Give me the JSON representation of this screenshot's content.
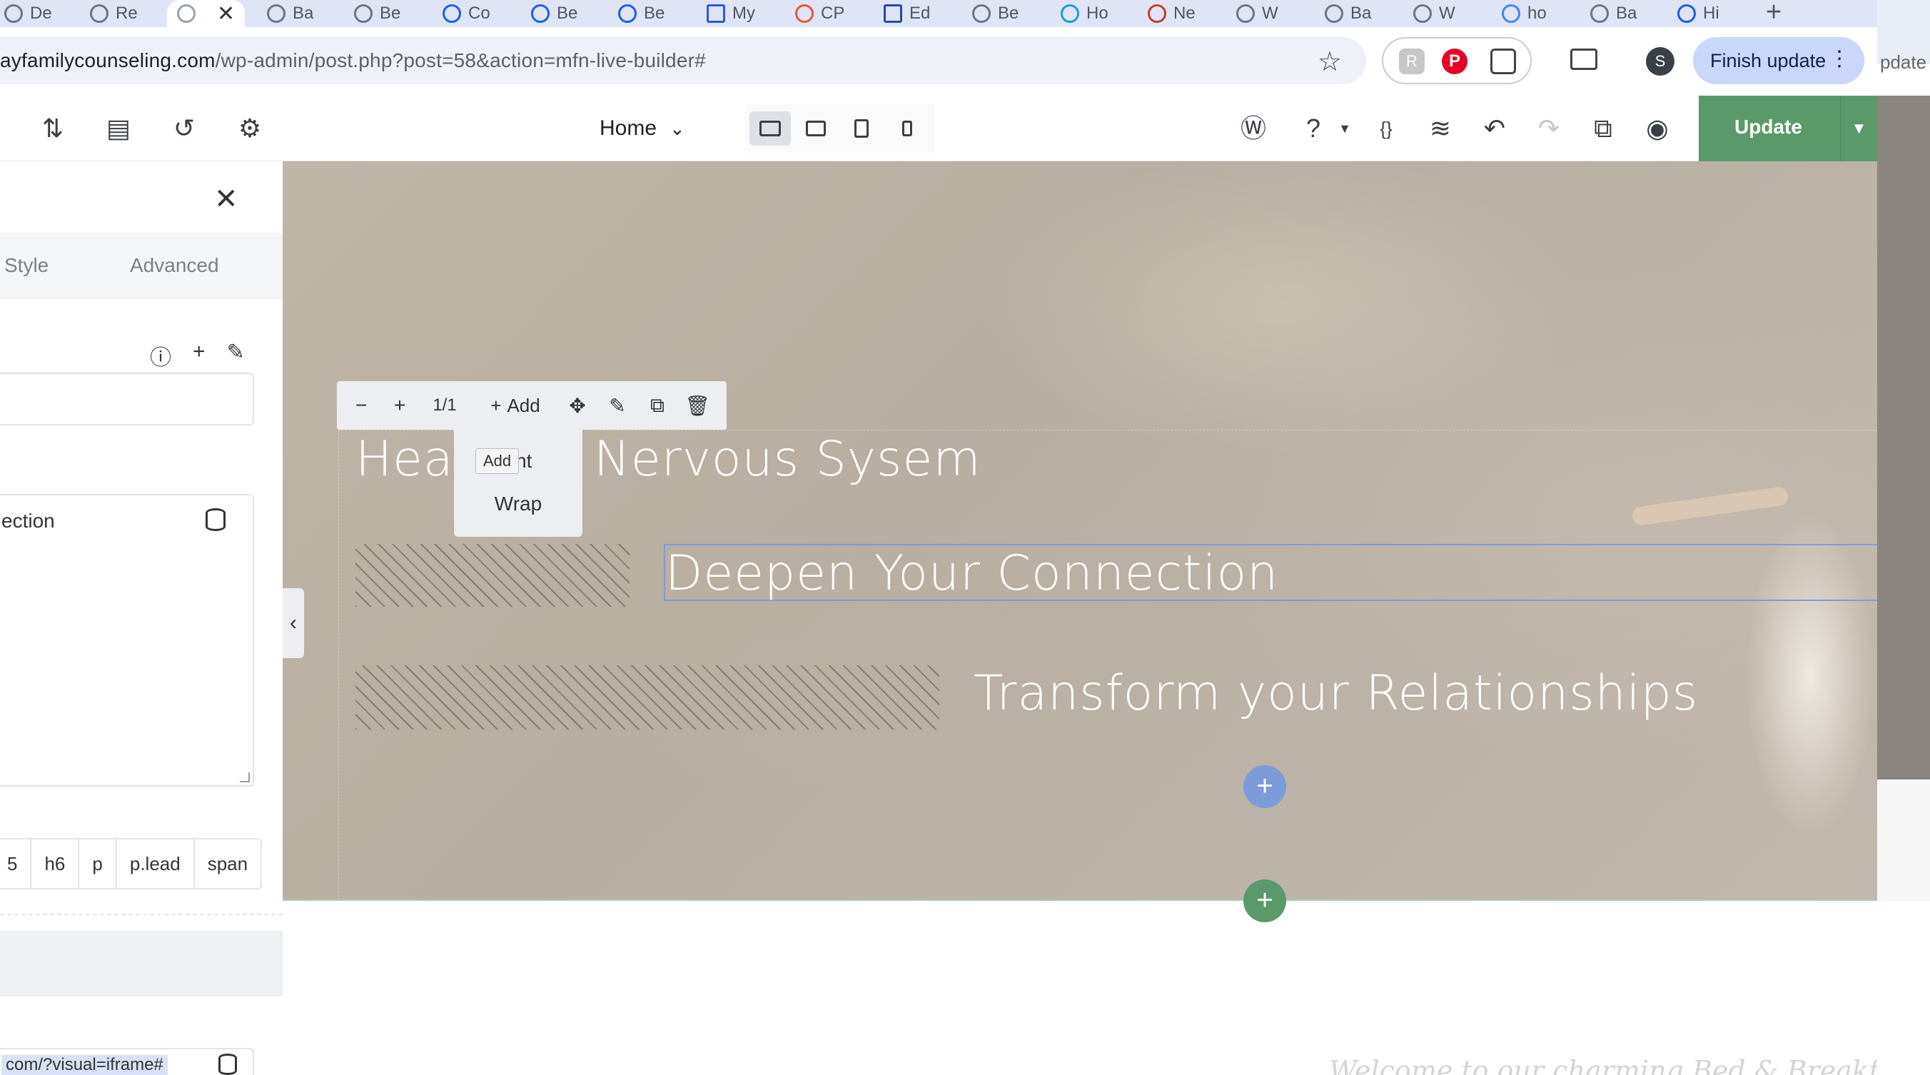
{
  "browser": {
    "tabs": [
      {
        "label": "De"
      },
      {
        "label": "Re"
      },
      {
        "label": ""
      },
      {
        "label": "Ba"
      },
      {
        "label": "Be"
      },
      {
        "label": "Co"
      },
      {
        "label": "Be"
      },
      {
        "label": "Be"
      },
      {
        "label": "My"
      },
      {
        "label": "CP"
      },
      {
        "label": "Ed"
      },
      {
        "label": "Be"
      },
      {
        "label": "Ho"
      },
      {
        "label": "Ne"
      },
      {
        "label": "W"
      },
      {
        "label": "Ba"
      },
      {
        "label": "W"
      },
      {
        "label": "ho"
      },
      {
        "label": "Ba"
      },
      {
        "label": "Hi"
      }
    ],
    "url_domain": "ayfamilycounseling.com",
    "url_path": "/wp-admin/post.php?post=58&action=mfn-live-builder#",
    "profile_initial": "S",
    "finish_update_label": "Finish update",
    "side_window_label": "pdate"
  },
  "builder": {
    "page_name": "Home",
    "update_label": "Update",
    "accent_color": "#5a9a6a"
  },
  "panel": {
    "tab_style": "Style",
    "tab_advanced": "Advanced",
    "content_value": "ection",
    "tags": [
      "5",
      "h6",
      "p",
      "p.lead",
      "span"
    ],
    "link_value": "com/?visual=iframe#"
  },
  "element_toolbar": {
    "counter": "1/1",
    "add_label": "Add",
    "dropdown_items": [
      "ent",
      "Wrap"
    ],
    "tooltip": "Add"
  },
  "hero": {
    "title_1_start": "Hea",
    "title_1_end": "Nervous Sysem",
    "title_2": "Deepen Your Connection",
    "title_3": "Transform your Relationships"
  },
  "footer_text": "Welcome to our charming Bed & Breakfast. Id"
}
